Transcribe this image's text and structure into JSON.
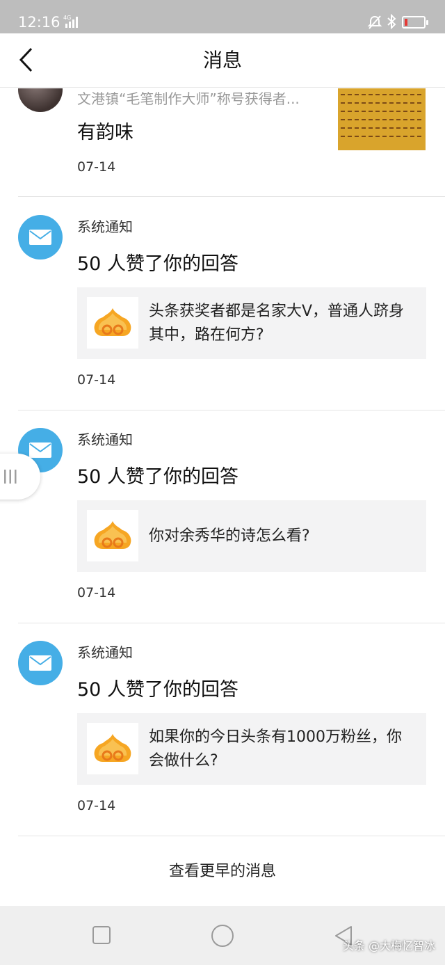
{
  "status_bar": {
    "time": "12:16",
    "network": "4G"
  },
  "header": {
    "title": "消息",
    "back_icon": "chevron-left-icon"
  },
  "messages": [
    {
      "sender": "文港镇“毛笔制作大师”称号获得者...",
      "text": "有韵味",
      "date": "07-14",
      "avatar": "user-photo",
      "thumbnail": "calligraphy-image"
    },
    {
      "sender": "系统通知",
      "text": "50 人赞了你的回答",
      "quote": "头条获奖者都是名家大V，普通人跻身其中，路在何方?",
      "date": "07-14",
      "avatar": "mail-icon"
    },
    {
      "sender": "系统通知",
      "text": "50 人赞了你的回答",
      "quote": "你对余秀华的诗怎么看?",
      "date": "07-14",
      "avatar": "mail-icon"
    },
    {
      "sender": "系统通知",
      "text": "50 人赞了你的回答",
      "quote": "如果你的今日头条有1000万粉丝，你会做什么?",
      "date": "07-14",
      "avatar": "mail-icon"
    }
  ],
  "footer": {
    "more_label": "查看更早的消息"
  },
  "watermark": "头条 @大梅忆智冰",
  "colors": {
    "accent_blue": "#45aee6",
    "status_bar": "#bdbdbd",
    "card_bg": "#f3f3f4",
    "battery_low": "#e53935"
  }
}
